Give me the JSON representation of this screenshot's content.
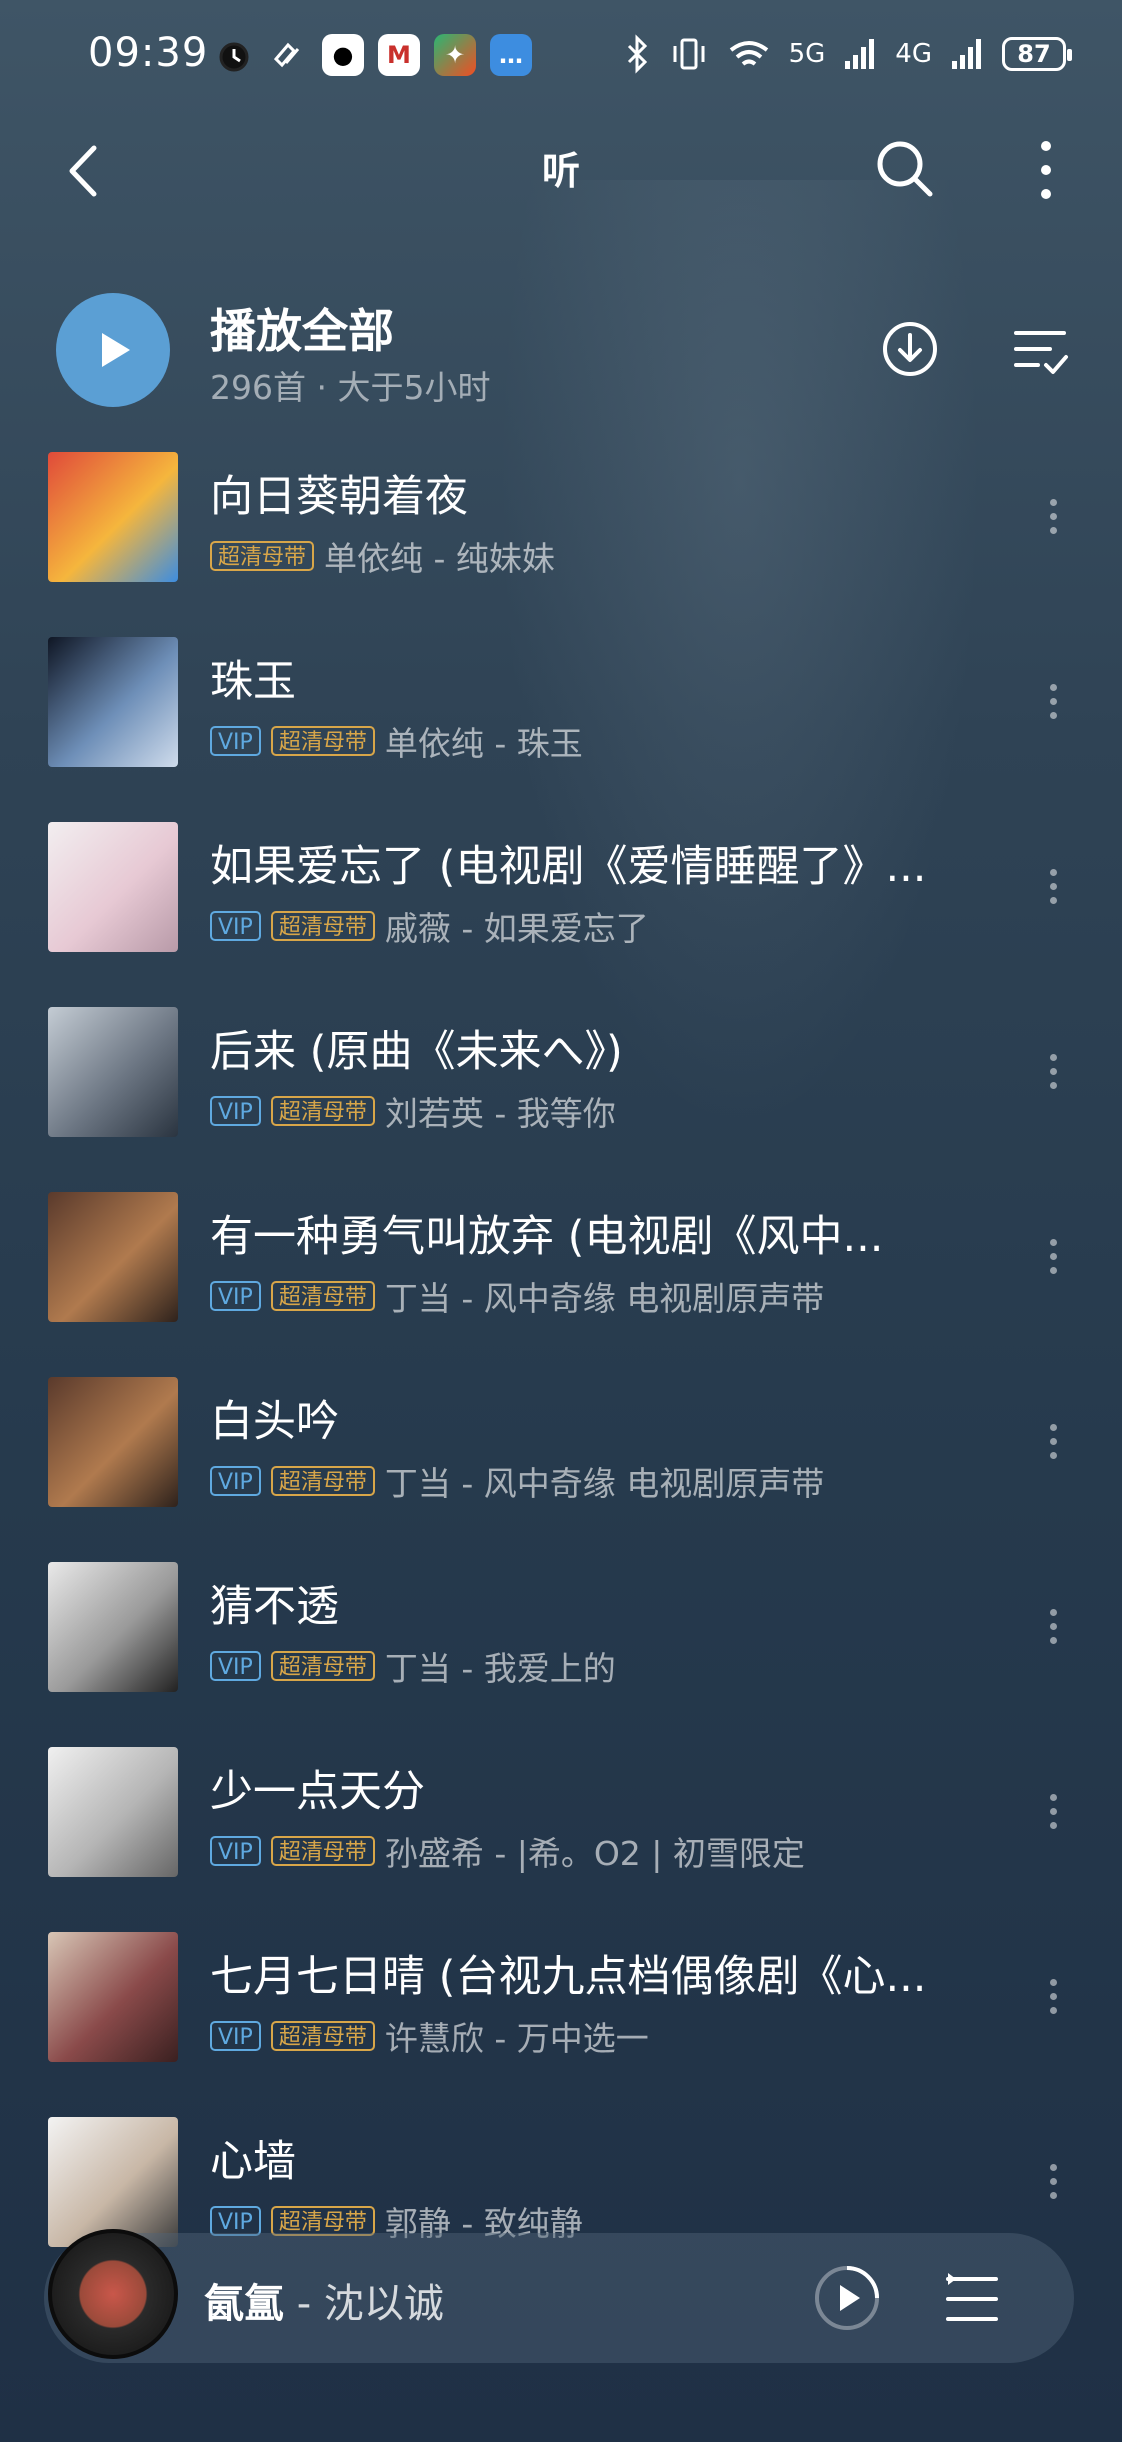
{
  "status": {
    "time": "09:39",
    "network_5g": "5G",
    "network_4g": "4G",
    "battery": "87"
  },
  "header": {
    "title": "听"
  },
  "play_all": {
    "label": "播放全部",
    "subtitle": "296首 · 大于5小时"
  },
  "tags": {
    "vip": "VIP",
    "hq": "超清母带"
  },
  "songs": [
    {
      "title": "向日葵朝着夜",
      "vip": false,
      "artist_album": "单依纯 - 纯妹妹",
      "cover": [
        "#e04a3a",
        "#f5b63d",
        "#3d8de0"
      ]
    },
    {
      "title": "珠玉",
      "vip": true,
      "artist_album": "单依纯 - 珠玉",
      "cover": [
        "#0f1624",
        "#6e8fb8",
        "#cfdcec"
      ]
    },
    {
      "title": "如果爱忘了 (电视剧《爱情睡醒了》...",
      "vip": true,
      "artist_album": "戚薇 - 如果爱忘了",
      "cover": [
        "#f2eef0",
        "#e7c9d4",
        "#b89aa8"
      ]
    },
    {
      "title": "后来 (原曲《未来へ》)",
      "vip": true,
      "artist_album": "刘若英 - 我等你",
      "cover": [
        "#c4ccd4",
        "#6d7784",
        "#2a3440"
      ]
    },
    {
      "title": "有一种勇气叫放弃 (电视剧《风中...",
      "vip": true,
      "artist_album": "丁当 - 风中奇缘 电视剧原声带",
      "cover": [
        "#5a3a2c",
        "#b07a4e",
        "#2e221c"
      ]
    },
    {
      "title": "白头吟",
      "vip": true,
      "artist_album": "丁当 - 风中奇缘 电视剧原声带",
      "cover": [
        "#5a3a2c",
        "#b07a4e",
        "#2e221c"
      ]
    },
    {
      "title": "猜不透",
      "vip": true,
      "artist_album": "丁当 - 我爱上的",
      "cover": [
        "#e9e9e9",
        "#9a9a9a",
        "#222222"
      ]
    },
    {
      "title": "少一点天分",
      "vip": true,
      "artist_album": "孙盛希 - |希。O2 | 初雪限定",
      "cover": [
        "#f0f0f0",
        "#b5b5b5",
        "#666666"
      ]
    },
    {
      "title": "七月七日晴 (台视九点档偶像剧《心...",
      "vip": true,
      "artist_album": "许慧欣 - 万中选一",
      "cover": [
        "#d8c6b6",
        "#8a4a4a",
        "#3a2020"
      ]
    },
    {
      "title": "心墙",
      "vip": true,
      "artist_album": "郭静 - 致纯静",
      "cover": [
        "#f3f3f3",
        "#c8b7a6",
        "#3a3a3a"
      ]
    }
  ],
  "mini_player": {
    "song": "氤氲",
    "artist": " - 沈以诚"
  }
}
